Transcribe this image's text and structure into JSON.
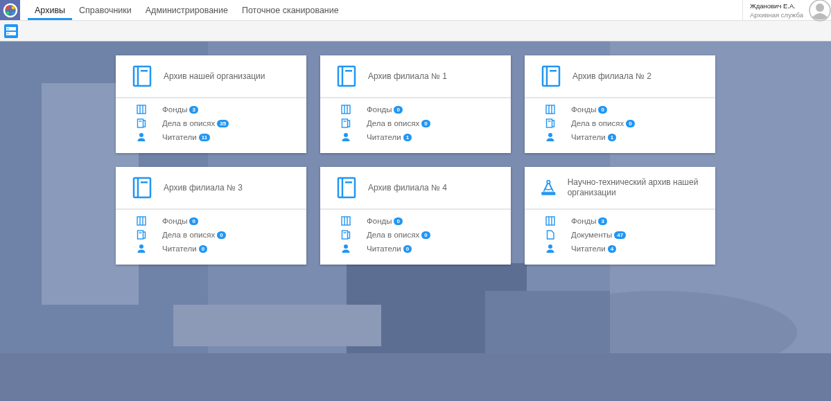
{
  "nav": {
    "tabs": [
      {
        "label": "Архивы",
        "selected": true
      },
      {
        "label": "Справочники",
        "selected": false
      },
      {
        "label": "Администрирование",
        "selected": false
      },
      {
        "label": "Поточное сканирование",
        "selected": false
      }
    ]
  },
  "user": {
    "name": "Жданович Е.А.",
    "role": "Архивная служба"
  },
  "archives": [
    {
      "kind": "book",
      "title": "Архив нашей организации",
      "stats": [
        {
          "kind": "funds",
          "label": "Фонды",
          "count": "3"
        },
        {
          "kind": "files",
          "label": "Дела в описях",
          "count": "35"
        },
        {
          "kind": "readers",
          "label": "Читатели",
          "count": "11"
        }
      ]
    },
    {
      "kind": "book",
      "title": "Архив филиала № 1",
      "stats": [
        {
          "kind": "funds",
          "label": "Фонды",
          "count": "0"
        },
        {
          "kind": "files",
          "label": "Дела в описях",
          "count": "0"
        },
        {
          "kind": "readers",
          "label": "Читатели",
          "count": "1"
        }
      ]
    },
    {
      "kind": "book",
      "title": "Архив филиала № 2",
      "stats": [
        {
          "kind": "funds",
          "label": "Фонды",
          "count": "0"
        },
        {
          "kind": "files",
          "label": "Дела в описях",
          "count": "0"
        },
        {
          "kind": "readers",
          "label": "Читатели",
          "count": "1"
        }
      ]
    },
    {
      "kind": "book",
      "title": "Архив филиала № 3",
      "stats": [
        {
          "kind": "funds",
          "label": "Фонды",
          "count": "0"
        },
        {
          "kind": "files",
          "label": "Дела в описях",
          "count": "0"
        },
        {
          "kind": "readers",
          "label": "Читатели",
          "count": "0"
        }
      ]
    },
    {
      "kind": "book",
      "title": "Архив филиала № 4",
      "stats": [
        {
          "kind": "funds",
          "label": "Фонды",
          "count": "0"
        },
        {
          "kind": "files",
          "label": "Дела в описях",
          "count": "0"
        },
        {
          "kind": "readers",
          "label": "Читатели",
          "count": "0"
        }
      ]
    },
    {
      "kind": "compass",
      "title": "Научно-технический архив нашей организации",
      "stats": [
        {
          "kind": "funds",
          "label": "Фонды",
          "count": "3"
        },
        {
          "kind": "documents",
          "label": "Документы",
          "count": "47"
        },
        {
          "kind": "readers",
          "label": "Читатели",
          "count": "4"
        }
      ]
    }
  ]
}
